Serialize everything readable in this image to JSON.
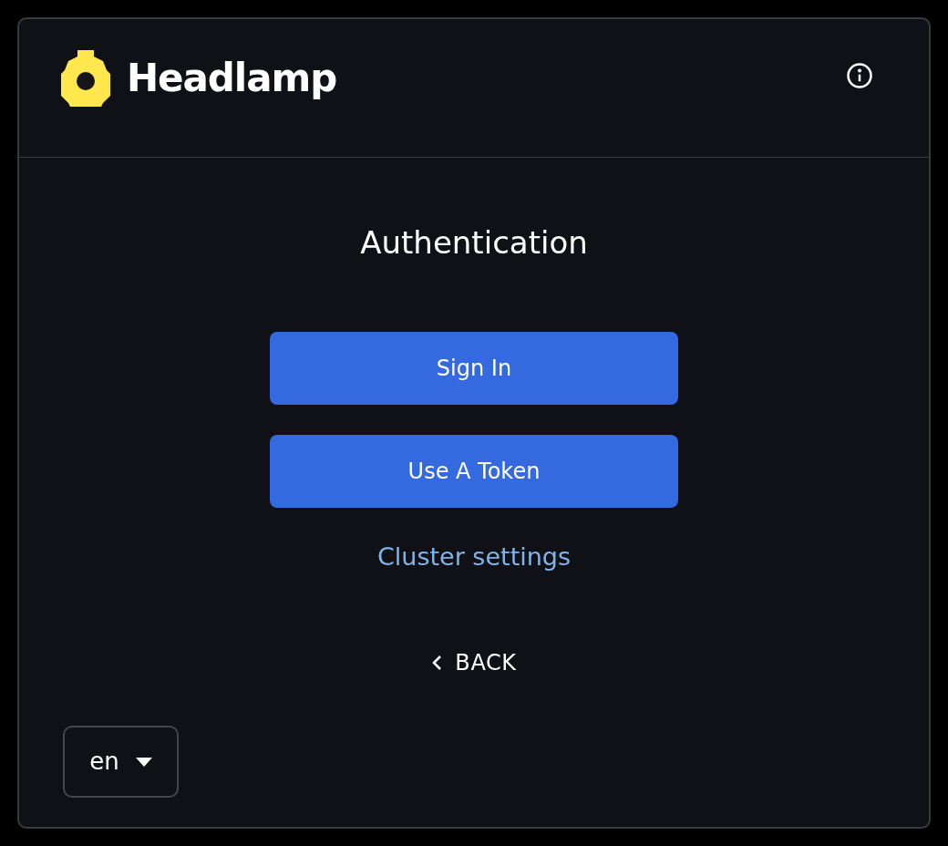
{
  "header": {
    "brand": "Headlamp"
  },
  "title": "Authentication",
  "buttons": [
    "Sign In",
    "Use A Token"
  ],
  "link": "Cluster settings",
  "back": "BACK",
  "language": {
    "value": "en"
  }
}
